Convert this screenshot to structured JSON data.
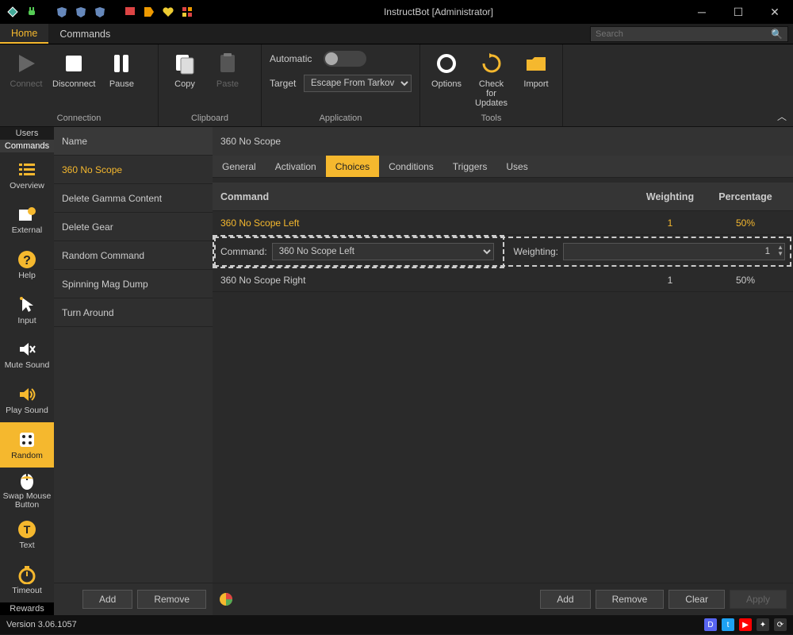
{
  "window": {
    "title": "InstructBot [Administrator]"
  },
  "menubar": {
    "tabs": [
      "Home",
      "Commands"
    ],
    "active": 0,
    "search_placeholder": "Search"
  },
  "ribbon": {
    "connection": {
      "caption": "Connection",
      "connect": "Connect",
      "disconnect": "Disconnect",
      "pause": "Pause"
    },
    "clipboard": {
      "caption": "Clipboard",
      "copy": "Copy",
      "paste": "Paste"
    },
    "application": {
      "caption": "Application",
      "automatic": "Automatic",
      "target": "Target",
      "target_value": "Escape From Tarkov"
    },
    "tools": {
      "caption": "Tools",
      "options": "Options",
      "checkupdates": "Check for\nUpdates",
      "import": "Import"
    }
  },
  "sidebar": {
    "cat_users": "Users",
    "cat_commands": "Commands",
    "cat_rewards": "Rewards",
    "items": [
      {
        "label": "Overview"
      },
      {
        "label": "External"
      },
      {
        "label": "Help"
      },
      {
        "label": "Input"
      },
      {
        "label": "Mute Sound"
      },
      {
        "label": "Play Sound"
      },
      {
        "label": "Random"
      },
      {
        "label": "Swap Mouse\nButton"
      },
      {
        "label": "Text"
      },
      {
        "label": "Timeout"
      }
    ],
    "active": 6
  },
  "cmdlist": {
    "header": "Name",
    "items": [
      "360 No Scope",
      "Delete Gamma Content",
      "Delete Gear",
      "Random Command",
      "Spinning Mag Dump",
      "Turn Around"
    ],
    "active": 0,
    "add": "Add",
    "remove": "Remove"
  },
  "detail": {
    "title": "360 No Scope",
    "tabs": [
      "General",
      "Activation",
      "Choices",
      "Conditions",
      "Triggers",
      "Uses"
    ],
    "active": 2,
    "grid": {
      "col_command": "Command",
      "col_weight": "Weighting",
      "col_pct": "Percentage",
      "rows": [
        {
          "command": "360 No Scope Left",
          "weight": "1",
          "pct": "50%",
          "selected": true
        },
        {
          "command": "360 No Scope Right",
          "weight": "1",
          "pct": "50%",
          "selected": false
        }
      ]
    },
    "editor": {
      "cmd_label": "Command:",
      "cmd_value": "360 No Scope Left",
      "w_label": "Weighting:",
      "w_value": "1"
    },
    "footer": {
      "add": "Add",
      "remove": "Remove",
      "clear": "Clear",
      "apply": "Apply"
    }
  },
  "status": {
    "version": "Version 3.06.1057"
  }
}
